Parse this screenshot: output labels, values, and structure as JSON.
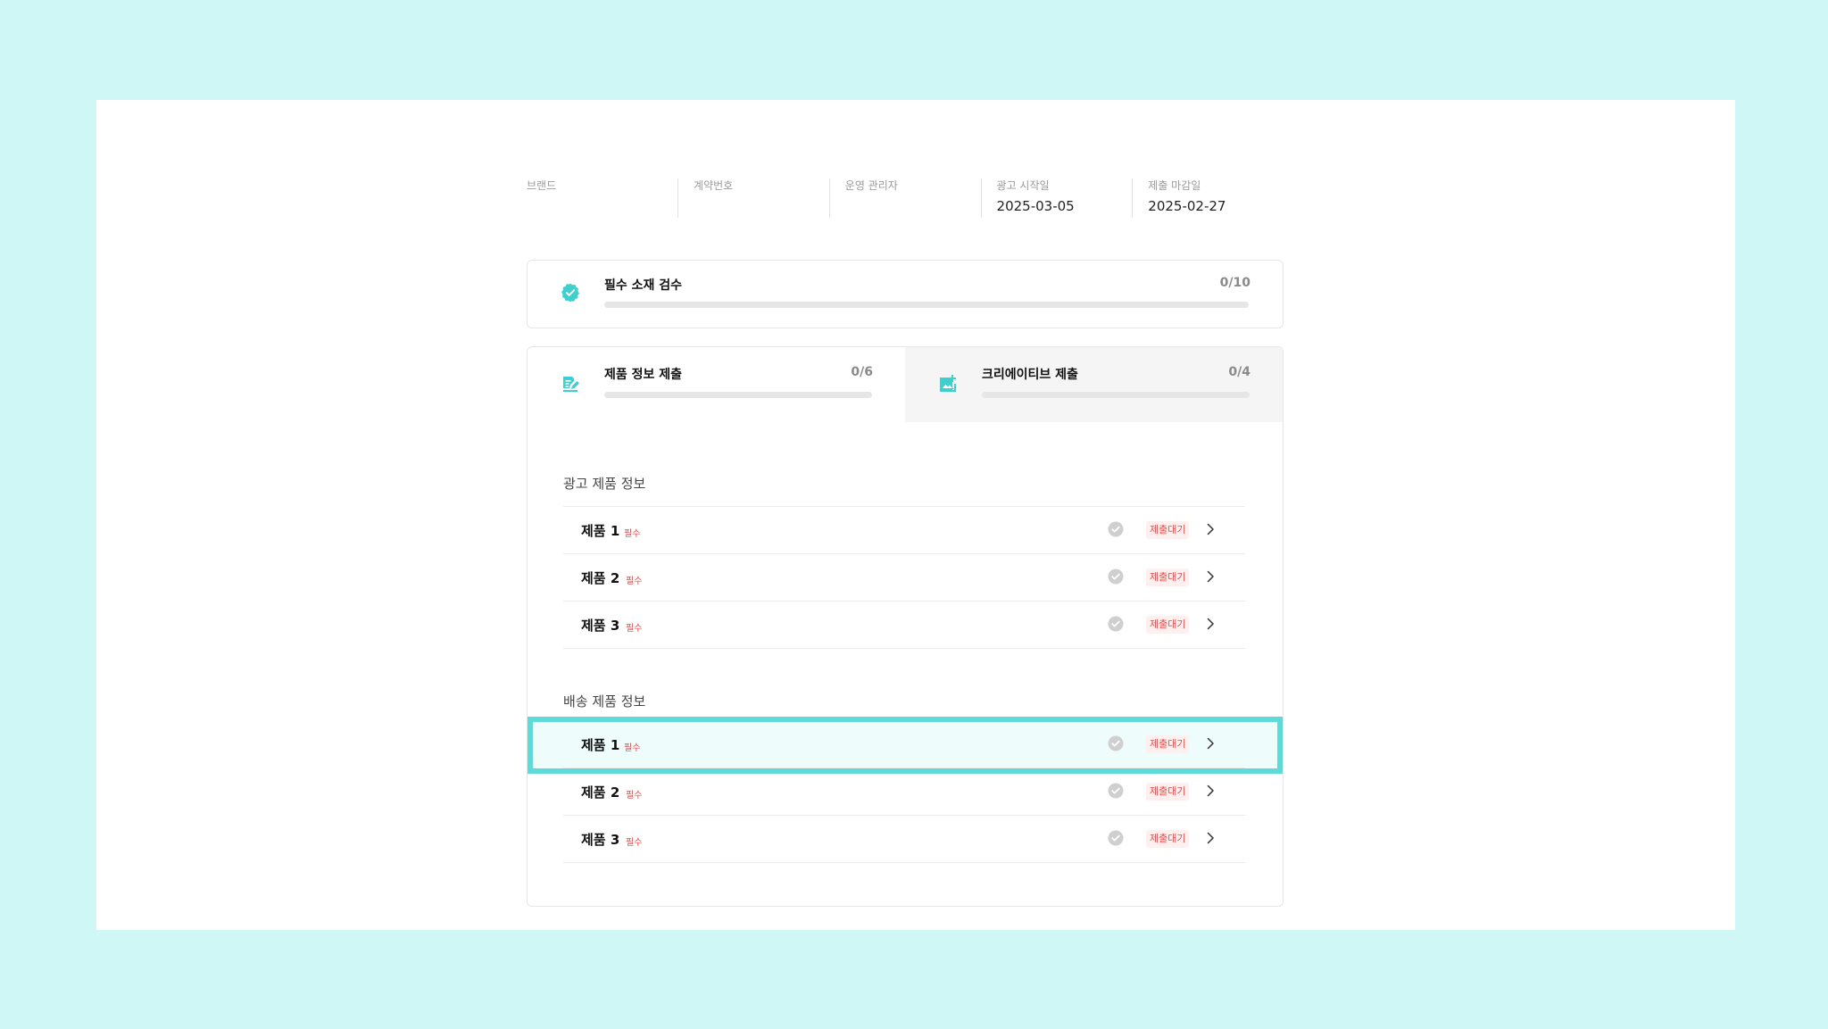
{
  "info": {
    "brand_label": "브랜드",
    "brand_value": "",
    "contract_label": "계약번호",
    "contract_value": "",
    "manager_label": "운영 관리자",
    "manager_value": "",
    "ad_start_label": "광고 시작일",
    "ad_start_value": "2025-03-05",
    "deadline_label": "제출 마감일",
    "deadline_value": "2025-02-27"
  },
  "required_check": {
    "title": "필수 소재 검수",
    "count": "0/10",
    "progress": 0
  },
  "tabs": [
    {
      "title": "제품 정보 제출",
      "count": "0/6",
      "progress": 0,
      "active": true
    },
    {
      "title": "크리에이티브 제출",
      "count": "0/4",
      "progress": 0,
      "active": false
    }
  ],
  "sections": [
    {
      "title": "광고 제품 정보",
      "items": [
        {
          "name": "제품 1",
          "required": "필수",
          "status": "제출대기"
        },
        {
          "name": "제품 2",
          "required": "필수",
          "status": "제출대기"
        },
        {
          "name": "제품 3",
          "required": "필수",
          "status": "제출대기"
        }
      ]
    },
    {
      "title": "배송 제품 정보",
      "items": [
        {
          "name": "제품 1",
          "required": "필수",
          "status": "제출대기"
        },
        {
          "name": "제품 2",
          "required": "필수",
          "status": "제출대기"
        },
        {
          "name": "제품 3",
          "required": "필수",
          "status": "제출대기"
        }
      ]
    }
  ],
  "colors": {
    "accent": "#3ed0cf",
    "highlight_border": "#5edad9",
    "status_red": "#e84a4a",
    "background": "#cff7f6"
  },
  "icons": {
    "required_check": "verified-badge-icon",
    "product_tab": "document-edit-icon",
    "creative_tab": "image-add-icon",
    "row_check": "check-circle-icon",
    "row_chevron": "chevron-right-icon"
  }
}
